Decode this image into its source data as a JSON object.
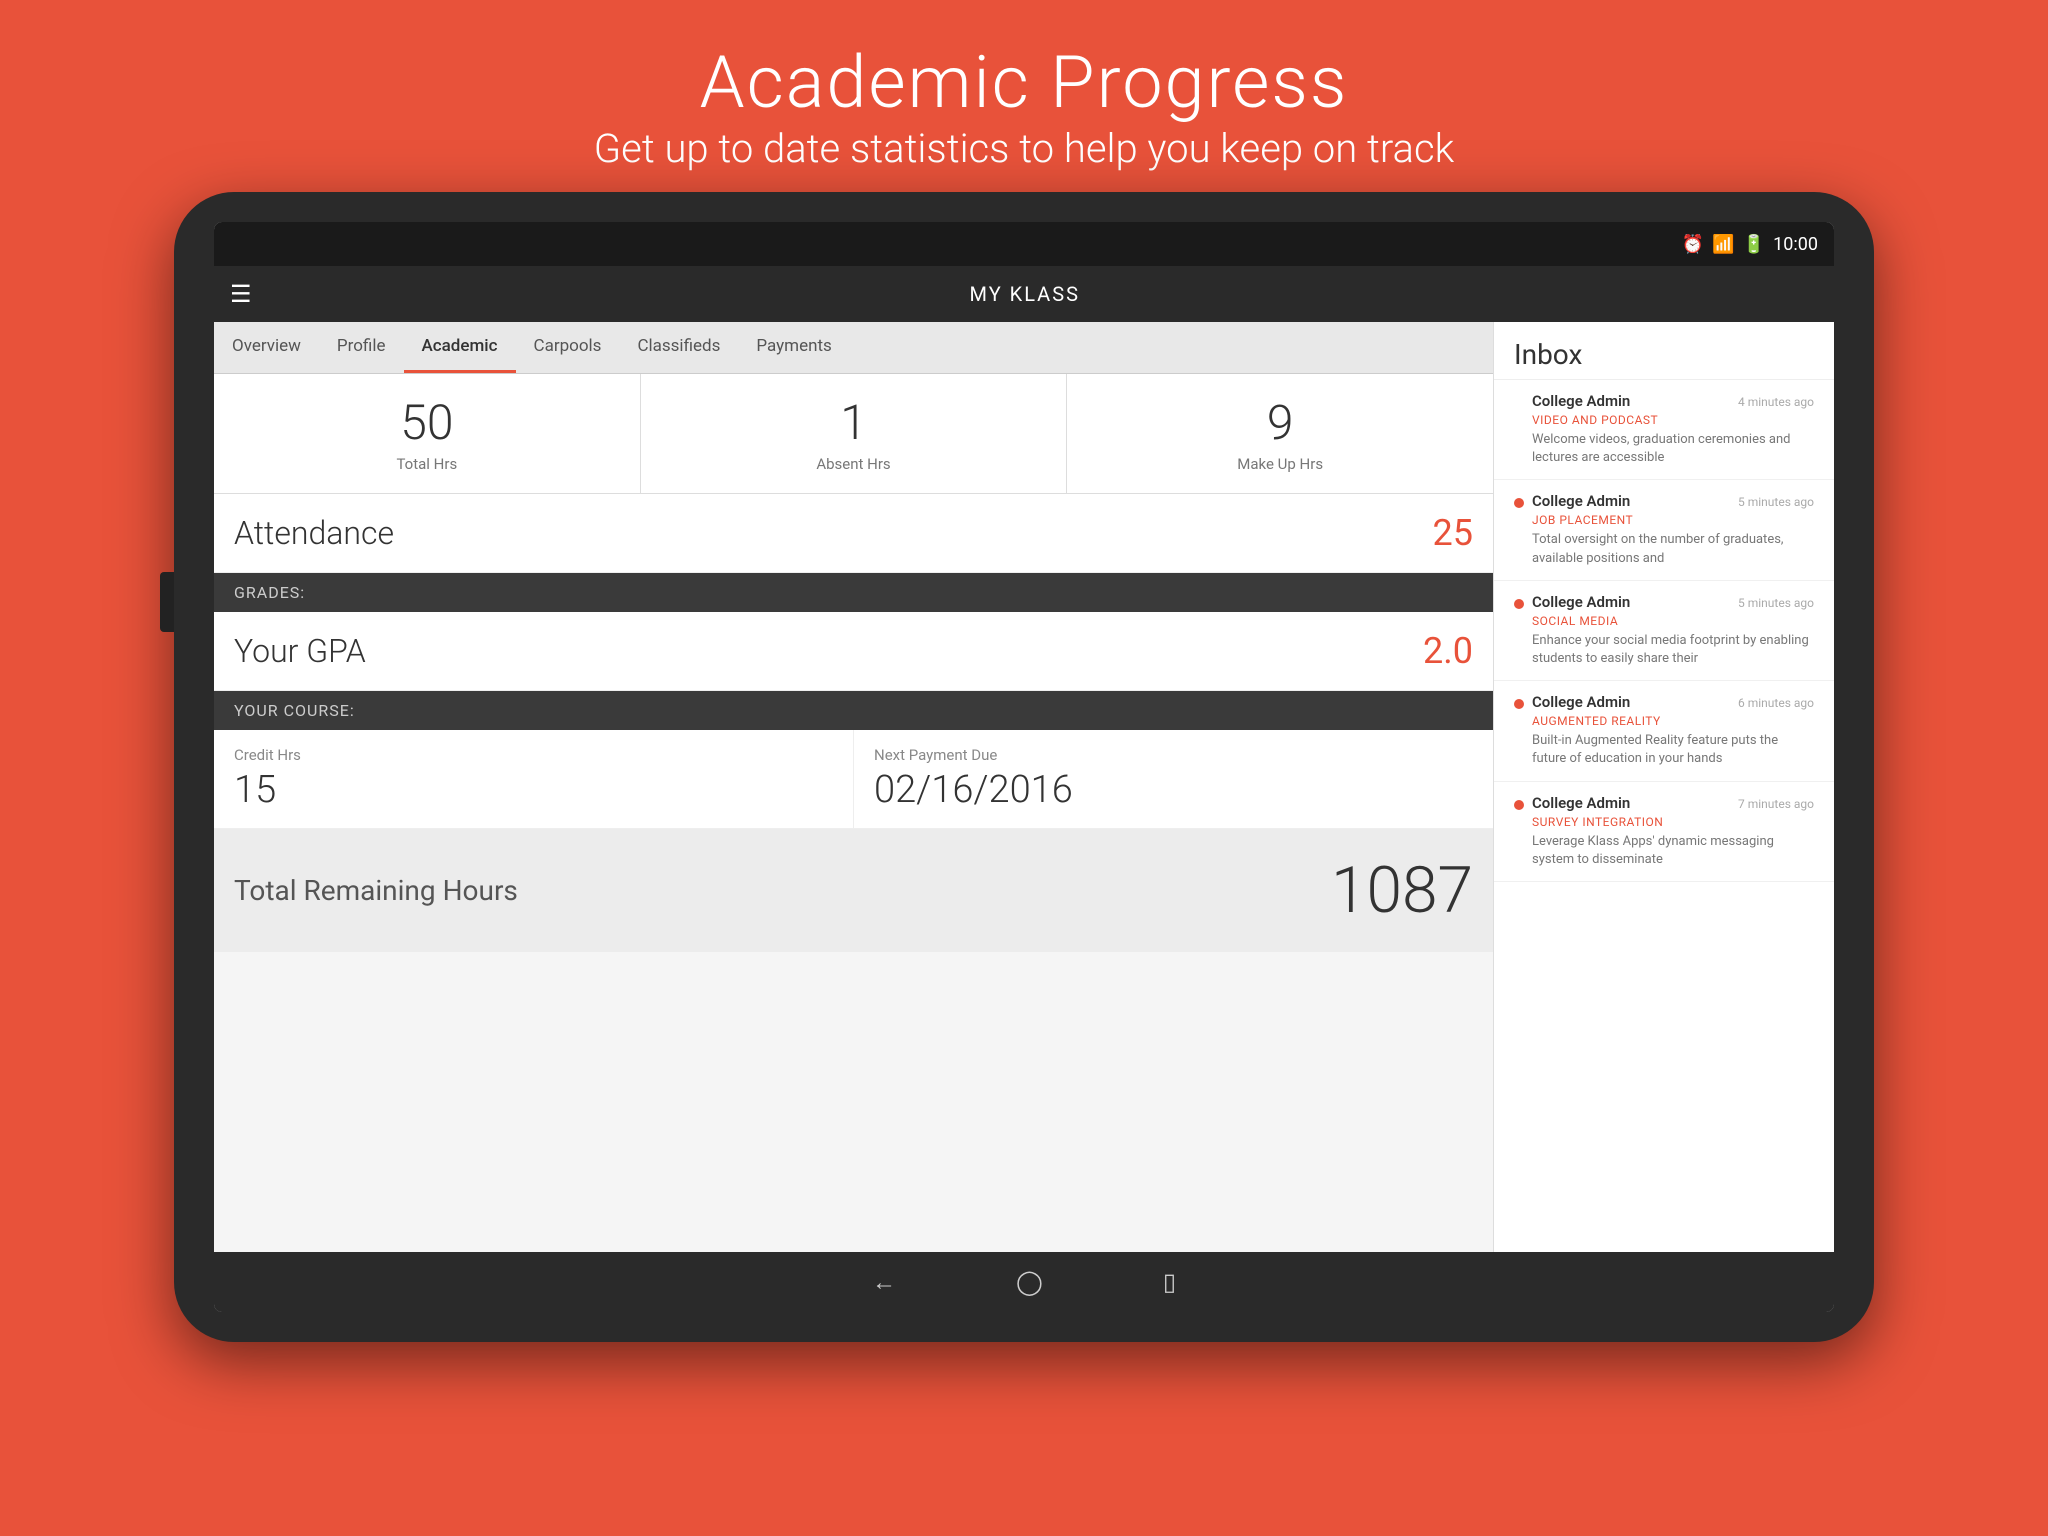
{
  "page": {
    "title": "Academic Progress",
    "subtitle": "Get up to date statistics to help you keep on track"
  },
  "statusBar": {
    "time": "10:00"
  },
  "appBar": {
    "title": "MY KLASS"
  },
  "tabs": [
    {
      "id": "overview",
      "label": "Overview",
      "active": false
    },
    {
      "id": "profile",
      "label": "Profile",
      "active": false
    },
    {
      "id": "academic",
      "label": "Academic",
      "active": true
    },
    {
      "id": "carpools",
      "label": "Carpools",
      "active": false
    },
    {
      "id": "classifieds",
      "label": "Classifieds",
      "active": false
    },
    {
      "id": "payments",
      "label": "Payments",
      "active": false
    }
  ],
  "stats": {
    "totalHrs": {
      "value": "50",
      "label": "Total Hrs"
    },
    "absentHrs": {
      "value": "1",
      "label": "Absent Hrs"
    },
    "makeUpHrs": {
      "value": "9",
      "label": "Make Up Hrs"
    }
  },
  "attendance": {
    "label": "Attendance",
    "value": "25"
  },
  "gradesBar": {
    "label": "GRADES:"
  },
  "gpa": {
    "label": "Your GPA",
    "value": "2.0"
  },
  "courseBar": {
    "label": "YOUR COURSE:"
  },
  "course": {
    "creditHrsLabel": "Credit Hrs",
    "creditHrsValue": "15",
    "nextPaymentLabel": "Next Payment Due",
    "nextPaymentValue": "02/16/2016"
  },
  "totalRemaining": {
    "label": "Total Remaining Hours",
    "value": "1087"
  },
  "inbox": {
    "title": "Inbox",
    "messages": [
      {
        "sender": "College Admin",
        "time": "4 minutes ago",
        "subject": "VIDEO AND PODCAST",
        "preview": "Welcome videos, graduation ceremonies and lectures are accessible",
        "unread": false
      },
      {
        "sender": "College Admin",
        "time": "5 minutes ago",
        "subject": "JOB PLACEMENT",
        "preview": "Total oversight on the number of graduates, available positions and",
        "unread": true
      },
      {
        "sender": "College Admin",
        "time": "5 minutes ago",
        "subject": "SOCIAL MEDIA",
        "preview": "Enhance your social media footprint by enabling students to easily share their",
        "unread": true
      },
      {
        "sender": "College Admin",
        "time": "6 minutes ago",
        "subject": "AUGMENTED REALITY",
        "preview": "Built-in Augmented Reality feature puts the future of education in your hands",
        "unread": true
      },
      {
        "sender": "College Admin",
        "time": "7 minutes ago",
        "subject": "SURVEY INTEGRATION",
        "preview": "Leverage Klass Apps' dynamic messaging system to disseminate",
        "unread": true
      }
    ]
  }
}
